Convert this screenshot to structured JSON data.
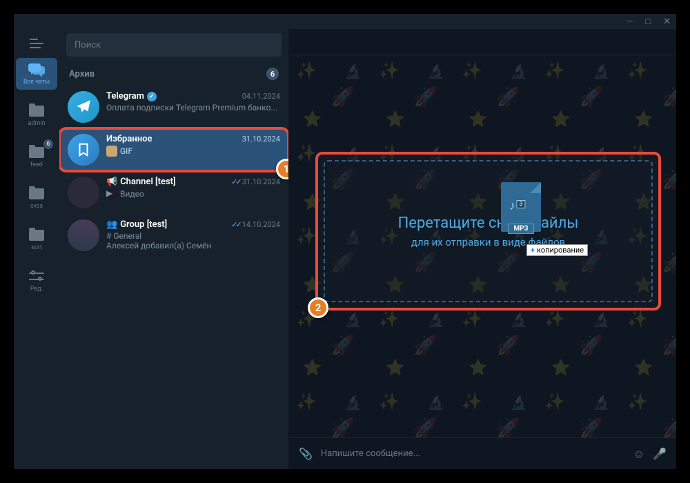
{
  "window_controls": {
    "min": "—",
    "max": "□",
    "close": "✕"
  },
  "tabs": {
    "all_chats": "Все чаты",
    "admin": "admin",
    "feed": "feed",
    "feed_badge": "6",
    "svcs": "svcs",
    "sort": "sort",
    "edit": "Ред."
  },
  "search_placeholder": "Поиск",
  "archive": {
    "label": "Архив",
    "count": "6"
  },
  "chats": [
    {
      "name": "Telegram",
      "date": "04.11.2024",
      "preview": "Оплата подписки Telegram Premium банко..."
    },
    {
      "name": "Избранное",
      "date": "31.10.2024",
      "preview": "GIF"
    },
    {
      "name": "Channel [test]",
      "date": "31.10.2024",
      "preview": "Видео"
    },
    {
      "name": "Group [test]",
      "date": "14.10.2024",
      "preview_label": "# General",
      "preview": "Алексей добавил(а) Семён"
    }
  ],
  "markers": {
    "one": "1",
    "two": "2"
  },
  "drop": {
    "title": "Перетащите сюда файлы",
    "subtitle": "для их отправки в виде файлов"
  },
  "drag_file": {
    "ext": "MP3",
    "count": "3",
    "tooltip": "копирование",
    "plus": "+"
  },
  "input_placeholder": "Напишите сообщение..."
}
